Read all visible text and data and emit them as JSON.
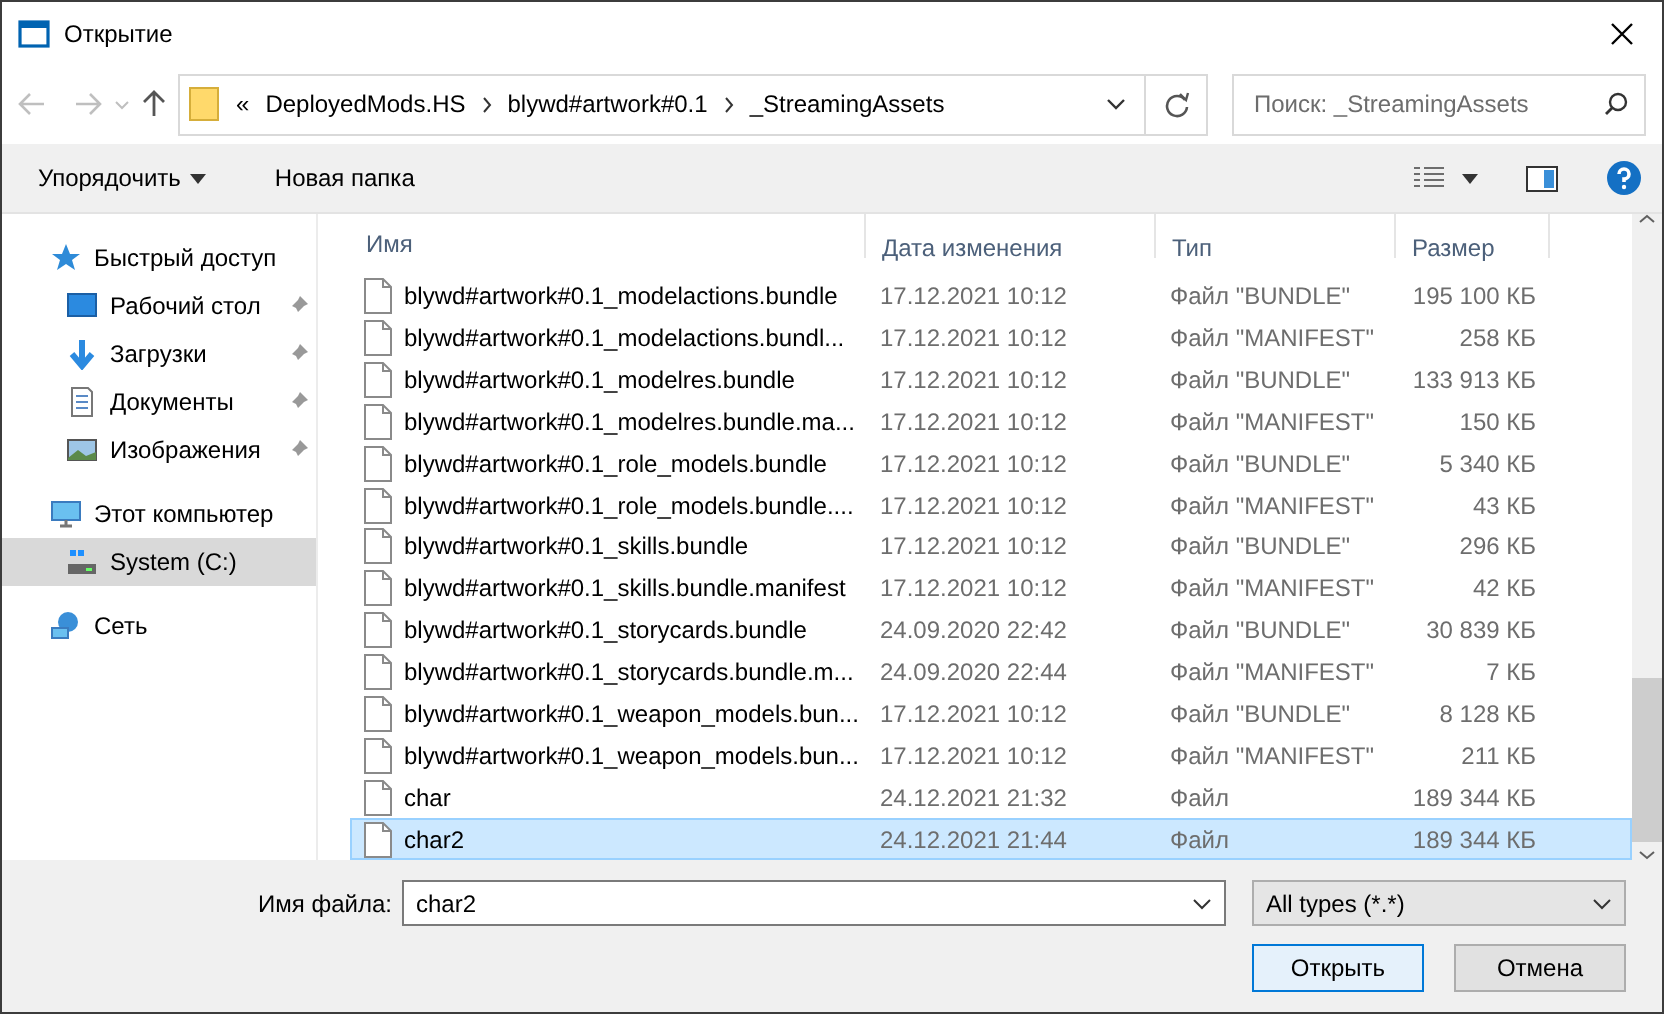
{
  "window": {
    "title": "Открытие"
  },
  "address": {
    "overflow": "«",
    "crumbs": [
      "DeployedMods.HS",
      "blywd#artwork#0.1",
      "_StreamingAssets"
    ]
  },
  "search": {
    "placeholder": "Поиск: _StreamingAssets"
  },
  "toolbar": {
    "organize": "Упорядочить",
    "new_folder": "Новая папка"
  },
  "sidebar": {
    "items": [
      {
        "label": "Быстрый доступ",
        "kind": "star",
        "pinned": false,
        "selected": false,
        "children": [
          {
            "label": "Рабочий стол",
            "kind": "desktop",
            "pinned": true,
            "selected": false
          },
          {
            "label": "Загрузки",
            "kind": "download",
            "pinned": true,
            "selected": false
          },
          {
            "label": "Документы",
            "kind": "document",
            "pinned": true,
            "selected": false
          },
          {
            "label": "Изображения",
            "kind": "image",
            "pinned": true,
            "selected": false
          }
        ]
      },
      {
        "label": "Этот компьютер",
        "kind": "computer",
        "pinned": false,
        "selected": false,
        "children": [
          {
            "label": "System (C:)",
            "kind": "drive",
            "pinned": false,
            "selected": true
          }
        ]
      },
      {
        "label": "Сеть",
        "kind": "network",
        "pinned": false,
        "selected": false
      }
    ]
  },
  "table": {
    "columns": [
      "Имя",
      "Дата изменения",
      "Тип",
      "Размер"
    ],
    "rows": [
      {
        "name": "blywd#artwork#0.1_modelactions.bundle",
        "date": "17.12.2021 10:12",
        "type": "Файл \"BUNDLE\"",
        "size": "195 100 КБ",
        "selected": false
      },
      {
        "name": "blywd#artwork#0.1_modelactions.bundl...",
        "date": "17.12.2021 10:12",
        "type": "Файл \"MANIFEST\"",
        "size": "258 КБ",
        "selected": false
      },
      {
        "name": "blywd#artwork#0.1_modelres.bundle",
        "date": "17.12.2021 10:12",
        "type": "Файл \"BUNDLE\"",
        "size": "133 913 КБ",
        "selected": false
      },
      {
        "name": "blywd#artwork#0.1_modelres.bundle.ma...",
        "date": "17.12.2021 10:12",
        "type": "Файл \"MANIFEST\"",
        "size": "150 КБ",
        "selected": false
      },
      {
        "name": "blywd#artwork#0.1_role_models.bundle",
        "date": "17.12.2021 10:12",
        "type": "Файл \"BUNDLE\"",
        "size": "5 340 КБ",
        "selected": false
      },
      {
        "name": "blywd#artwork#0.1_role_models.bundle....",
        "date": "17.12.2021 10:12",
        "type": "Файл \"MANIFEST\"",
        "size": "43 КБ",
        "selected": false
      },
      {
        "name": "blywd#artwork#0.1_skills.bundle",
        "date": "17.12.2021 10:12",
        "type": "Файл \"BUNDLE\"",
        "size": "296 КБ",
        "selected": false
      },
      {
        "name": "blywd#artwork#0.1_skills.bundle.manifest",
        "date": "17.12.2021 10:12",
        "type": "Файл \"MANIFEST\"",
        "size": "42 КБ",
        "selected": false
      },
      {
        "name": "blywd#artwork#0.1_storycards.bundle",
        "date": "24.09.2020 22:42",
        "type": "Файл \"BUNDLE\"",
        "size": "30 839 КБ",
        "selected": false
      },
      {
        "name": "blywd#artwork#0.1_storycards.bundle.m...",
        "date": "24.09.2020 22:44",
        "type": "Файл \"MANIFEST\"",
        "size": "7 КБ",
        "selected": false
      },
      {
        "name": "blywd#artwork#0.1_weapon_models.bun...",
        "date": "17.12.2021 10:12",
        "type": "Файл \"BUNDLE\"",
        "size": "8 128 КБ",
        "selected": false
      },
      {
        "name": "blywd#artwork#0.1_weapon_models.bun...",
        "date": "17.12.2021 10:12",
        "type": "Файл \"MANIFEST\"",
        "size": "211 КБ",
        "selected": false
      },
      {
        "name": "char",
        "date": "24.12.2021 21:32",
        "type": "Файл",
        "size": "189 344 КБ",
        "selected": false
      },
      {
        "name": "char2",
        "date": "24.12.2021 21:44",
        "type": "Файл",
        "size": "189 344 КБ",
        "selected": true
      }
    ]
  },
  "footer": {
    "filename_label": "Имя файла:",
    "filename": "char2",
    "filter": "All types (*.*)",
    "open": "Открыть",
    "cancel": "Отмена"
  }
}
